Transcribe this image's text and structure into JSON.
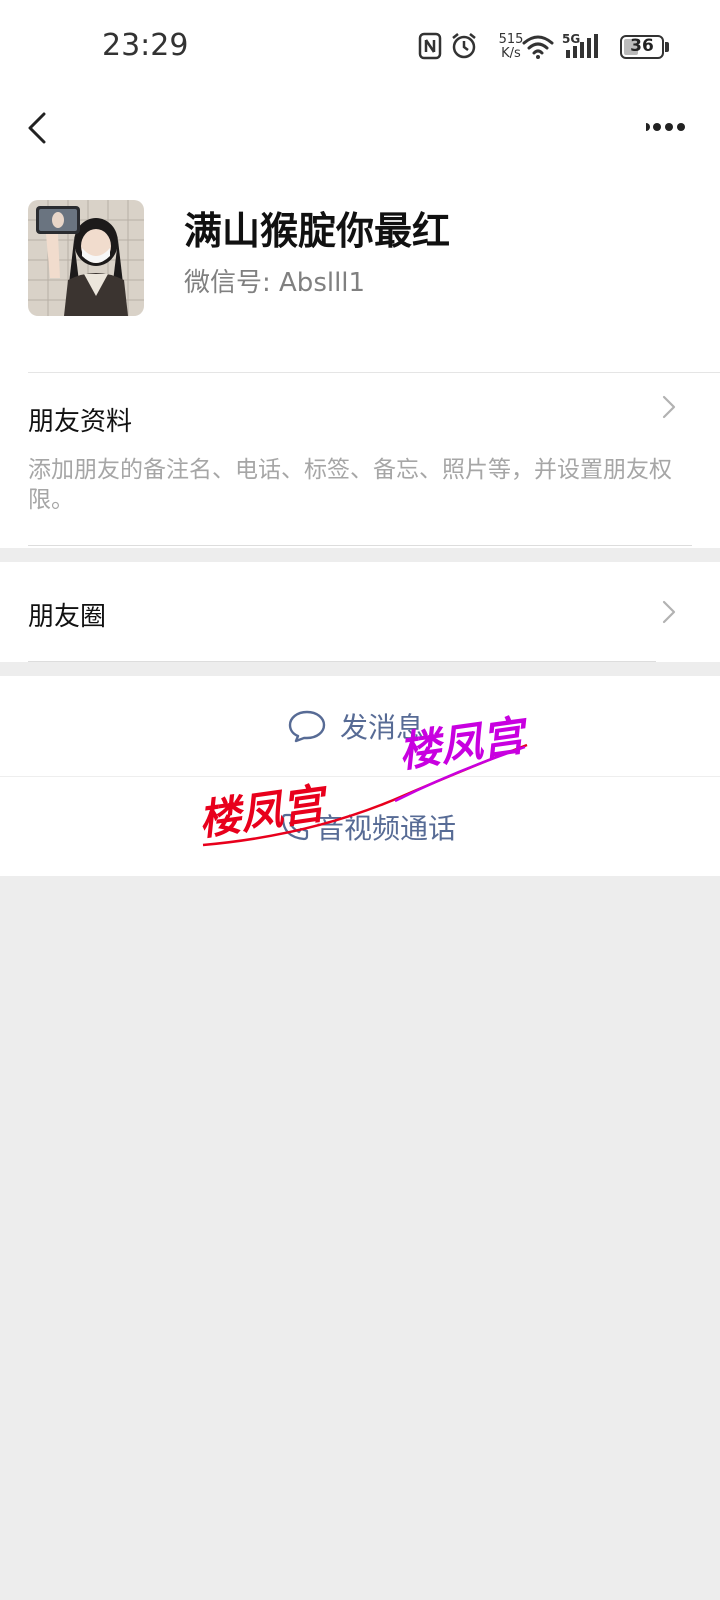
{
  "status_bar": {
    "time": "23:29",
    "net_speed_value": "515",
    "net_speed_unit": "K/s",
    "network_type": "5G",
    "battery_level": "36",
    "icons": [
      "nfc-icon",
      "alarm-icon",
      "wifi-icon",
      "signal-icon",
      "battery-icon"
    ]
  },
  "nav": {
    "back_icon": "chevron-left-icon",
    "more_icon": "more-dots-icon"
  },
  "profile": {
    "display_name": "满山猴腚你最红",
    "wechat_id_label": "微信号: Abslll1"
  },
  "friend_info": {
    "title": "朋友资料",
    "description": "添加朋友的备注名、电话、标签、备忘、照片等，并设置朋友权限。"
  },
  "moments": {
    "title": "朋友圈"
  },
  "actions": {
    "send_message": "发消息",
    "video_call": "音视频通话"
  },
  "watermark": {
    "text_1": "楼凤宫",
    "text_2": "楼凤宫"
  },
  "colors": {
    "link_blue": "#576b95",
    "background_gray": "#ededed",
    "watermark_red": "#e8001c",
    "watermark_magenta": "#c800e0"
  }
}
